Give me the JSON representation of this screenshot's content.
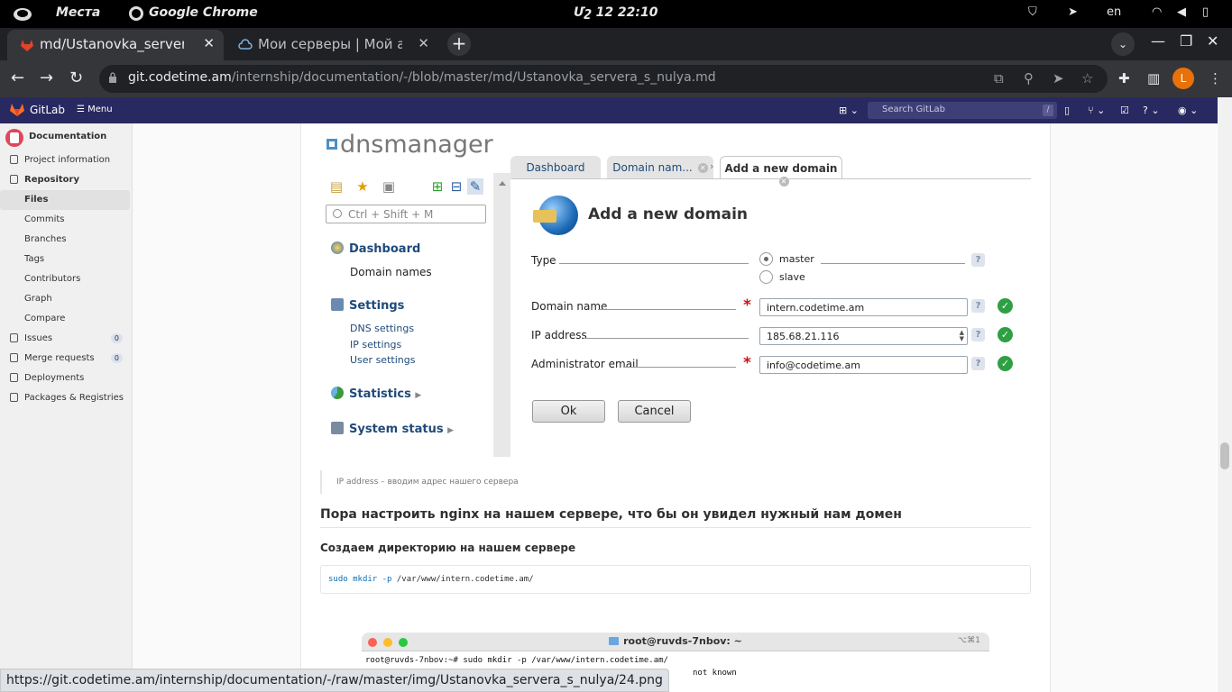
{
  "os": {
    "places": "Места",
    "app": "Google Chrome",
    "clock": "Մշ 12  22:10",
    "lang": "en"
  },
  "tabs": [
    {
      "title": "md/Ustanovka_servera_s",
      "active": true
    },
    {
      "title": "Мои серверы | Мой акк",
      "active": false
    }
  ],
  "omnibox": {
    "host": "git.codetime.am",
    "path": "/internship/documentation/-/blob/master/md/Ustanovka_servera_s_nulya.md"
  },
  "profile_initial": "L",
  "gitlab": {
    "brand": "GitLab",
    "menu": "Menu",
    "search_placeholder": "Search GitLab",
    "search_key": "/"
  },
  "sidebar": {
    "project": "Documentation",
    "items": [
      {
        "label": "Project information"
      },
      {
        "label": "Repository"
      },
      {
        "label": "Files"
      },
      {
        "label": "Commits"
      },
      {
        "label": "Branches"
      },
      {
        "label": "Tags"
      },
      {
        "label": "Contributors"
      },
      {
        "label": "Graph"
      },
      {
        "label": "Compare"
      },
      {
        "label": "Issues",
        "count": "0"
      },
      {
        "label": "Merge requests",
        "count": "0"
      },
      {
        "label": "Deployments"
      },
      {
        "label": "Packages & Registries"
      }
    ]
  },
  "dns": {
    "logo": "dnsmanager",
    "search_placeholder": "Ctrl + Shift + M",
    "nav": {
      "dashboard": "Dashboard",
      "domain_names": "Domain names",
      "settings": "Settings",
      "dns_settings": "DNS settings",
      "ip_settings": "IP settings",
      "user_settings": "User settings",
      "statistics": "Statistics",
      "system_status": "System status"
    },
    "tabs": [
      "Dashboard",
      "Domain nam...",
      "Add a new domain"
    ],
    "form_title": "Add a new domain",
    "fields": {
      "type_label": "Type",
      "type_master": "master",
      "type_slave": "slave",
      "domain_label": "Domain name",
      "domain_value": "intern.codetime.am",
      "ip_label": "IP address",
      "ip_value": "185.68.21.116",
      "email_label": "Administrator email",
      "email_value": "info@codetime.am"
    },
    "help": "?",
    "ok": "Ok",
    "cancel": "Cancel"
  },
  "doc": {
    "caption": "IP address – вводим адрес нашего сервера",
    "h3": "Пора настроить nginx на нашем сервере, что бы он увидел нужный нам домен",
    "h4": "Создаем директорию на нашем сервере",
    "code": {
      "cmd1": "sudo",
      "cmd2": "mkdir",
      "flag": "-p",
      "arg": "/var/www/intern.codetime.am/"
    }
  },
  "terminal": {
    "title": "root@ruvds-7nbov: ~",
    "shortcut": "⌥⌘1",
    "line1": "root@ruvds-7nbov:~# sudo mkdir -p /var/www/intern.codetime.am/",
    "line2": "not known"
  },
  "status_url": "https://git.codetime.am/internship/documentation/-/raw/master/img/Ustanovka_servera_s_nulya/24.png"
}
